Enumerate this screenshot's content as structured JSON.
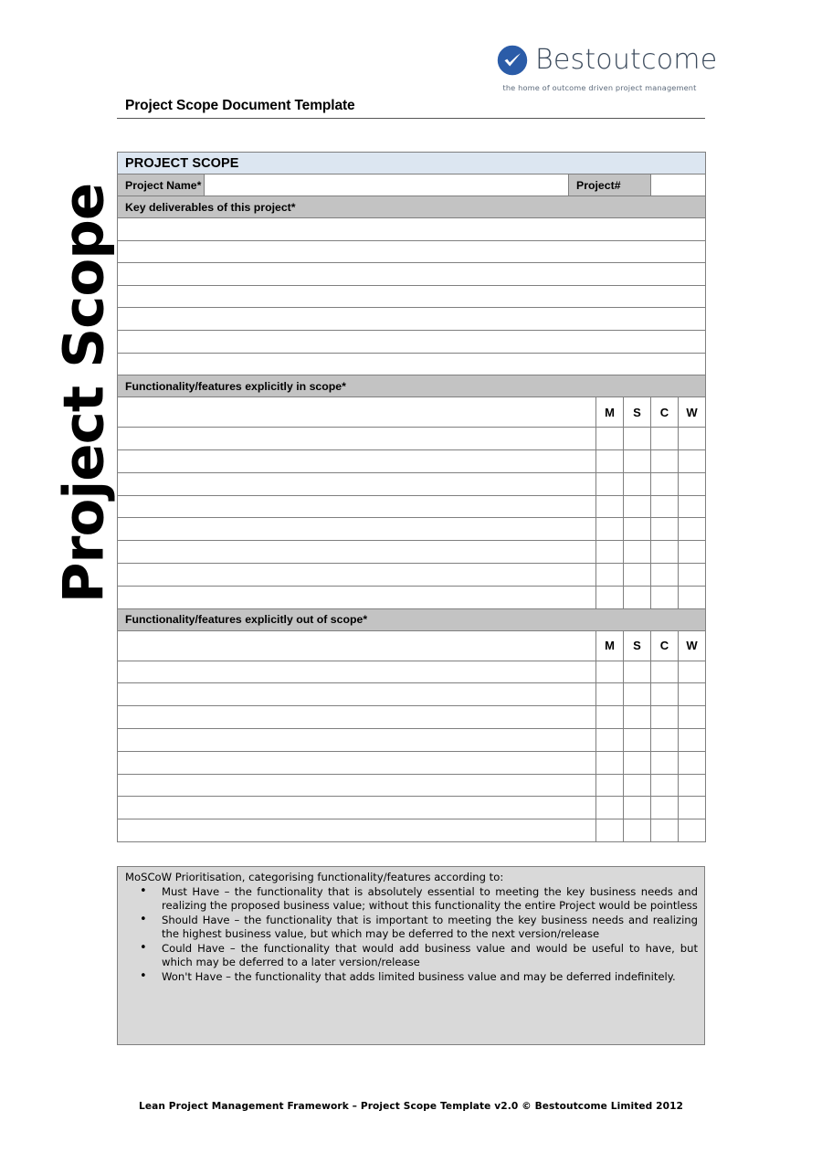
{
  "brand": {
    "name": "Bestoutcome",
    "tagline": "the home of outcome driven project management",
    "logo_icon": "check-circle-icon",
    "logo_color": "#2b5ca8"
  },
  "document": {
    "title": "Project Scope Document Template",
    "side_title": "Project Scope"
  },
  "colors": {
    "band_blue": "#dce6f1",
    "band_gray": "#c3c3c3",
    "notes_gray": "#d9d9d9",
    "border": "#7f7f7f"
  },
  "table": {
    "section_title": "PROJECT SCOPE",
    "project_name_label": "Project Name*",
    "project_name_value": "",
    "project_number_label": "Project#",
    "project_number_value": "",
    "deliverables_header": "Key deliverables of this project*",
    "deliverables_rows": [
      "",
      "",
      "",
      "",
      "",
      "",
      ""
    ],
    "in_scope_header": "Functionality/features explicitly in scope*",
    "out_of_scope_header": "Functionality/features explicitly out of scope*",
    "mscw_columns": [
      "M",
      "S",
      "C",
      "W"
    ],
    "in_scope_rows": [
      {
        "item": "",
        "m": "",
        "s": "",
        "c": "",
        "w": ""
      },
      {
        "item": "",
        "m": "",
        "s": "",
        "c": "",
        "w": ""
      },
      {
        "item": "",
        "m": "",
        "s": "",
        "c": "",
        "w": ""
      },
      {
        "item": "",
        "m": "",
        "s": "",
        "c": "",
        "w": ""
      },
      {
        "item": "",
        "m": "",
        "s": "",
        "c": "",
        "w": ""
      },
      {
        "item": "",
        "m": "",
        "s": "",
        "c": "",
        "w": ""
      },
      {
        "item": "",
        "m": "",
        "s": "",
        "c": "",
        "w": ""
      },
      {
        "item": "",
        "m": "",
        "s": "",
        "c": "",
        "w": ""
      }
    ],
    "out_of_scope_rows": [
      {
        "item": "",
        "m": "",
        "s": "",
        "c": "",
        "w": ""
      },
      {
        "item": "",
        "m": "",
        "s": "",
        "c": "",
        "w": ""
      },
      {
        "item": "",
        "m": "",
        "s": "",
        "c": "",
        "w": ""
      },
      {
        "item": "",
        "m": "",
        "s": "",
        "c": "",
        "w": ""
      },
      {
        "item": "",
        "m": "",
        "s": "",
        "c": "",
        "w": ""
      },
      {
        "item": "",
        "m": "",
        "s": "",
        "c": "",
        "w": ""
      },
      {
        "item": "",
        "m": "",
        "s": "",
        "c": "",
        "w": ""
      },
      {
        "item": "",
        "m": "",
        "s": "",
        "c": "",
        "w": ""
      }
    ]
  },
  "moscow": {
    "intro": "MoSCoW Prioritisation, categorising functionality/features according to:",
    "items": [
      "Must Have – the functionality that is absolutely essential to meeting the key business needs and realizing the proposed business value; without this functionality the entire Project would be pointless",
      "Should Have – the functionality that is important to meeting the key business needs and realizing the highest business value, but which may be deferred to the next version/release",
      "Could Have – the functionality that would add business value and would be useful to have, but which may be deferred to a later version/release",
      "Won't Have – the functionality that adds limited business value and may be deferred indefinitely."
    ]
  },
  "footer": {
    "text": "Lean Project Management Framework – Project Scope Template v2.0 © Bestoutcome Limited 2012"
  }
}
